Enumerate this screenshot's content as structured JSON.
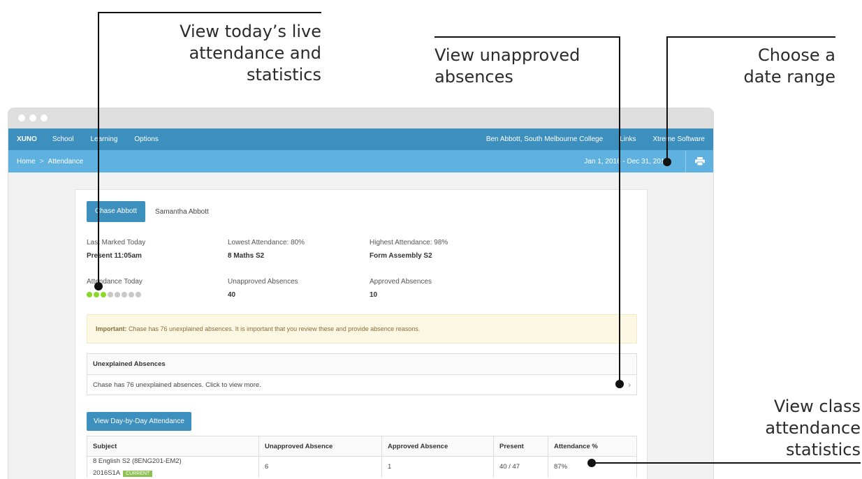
{
  "annotations": {
    "live_attendance": [
      "View today’s live",
      "attendance and",
      "statistics"
    ],
    "unapproved": [
      "View unapproved",
      "absences"
    ],
    "date_range": [
      "Choose a",
      "date range"
    ],
    "class_stats": [
      "View class",
      "attendance",
      "statistics"
    ]
  },
  "nav": {
    "brand": "XUNO",
    "items": [
      "School",
      "Learning",
      "Options"
    ],
    "user": "Ben Abbott, South Melbourne College",
    "links": "Links",
    "software": "Xtreme Software"
  },
  "breadcrumb": {
    "home": "Home",
    "sep": ">",
    "current": "Attendance"
  },
  "date_range": "Jan 1, 2016 - Dec 31, 2016",
  "students": {
    "active": "Chase Abbott",
    "other": "Samantha Abbott"
  },
  "stats": {
    "last_marked": {
      "label": "Last Marked Today",
      "value": "Present 11:05am"
    },
    "lowest": {
      "label": "Lowest Attendance: 80%",
      "value": "8 Maths S2"
    },
    "highest": {
      "label": "Highest Attendance: 98%",
      "value": "Form Assembly S2"
    },
    "today": {
      "label": "Attendance Today",
      "present_periods": 3,
      "total_periods": 8
    },
    "unapproved": {
      "label": "Unapproved Absences",
      "value": "40"
    },
    "approved": {
      "label": "Approved Absences",
      "value": "10"
    }
  },
  "alert": {
    "strong": "Important:",
    "text": "Chase has 76 unexplained absences. It is important that you review these and provide absence reasons."
  },
  "unexplained": {
    "title": "Unexplained Absences",
    "text": "Chase has 76 unexplained absences. Click to view more."
  },
  "day_button": "View Day-by-Day Attendance",
  "table": {
    "headers": [
      "Subject",
      "Unapproved Absence",
      "Approved Absence",
      "Present",
      "Attendance %"
    ],
    "rows": [
      {
        "subject": "8 English S2 (8ENG201-EM2)",
        "term": "2016S1A",
        "badge": "CURRENT",
        "unapproved": "6",
        "approved": "1",
        "present": "40 / 47",
        "pct": "87%"
      }
    ]
  },
  "colors": {
    "nav": "#3d8fbe",
    "subbar": "#5fb1e0",
    "dot_present": "#8dd62b",
    "dot_absent": "#c8c8c8"
  }
}
